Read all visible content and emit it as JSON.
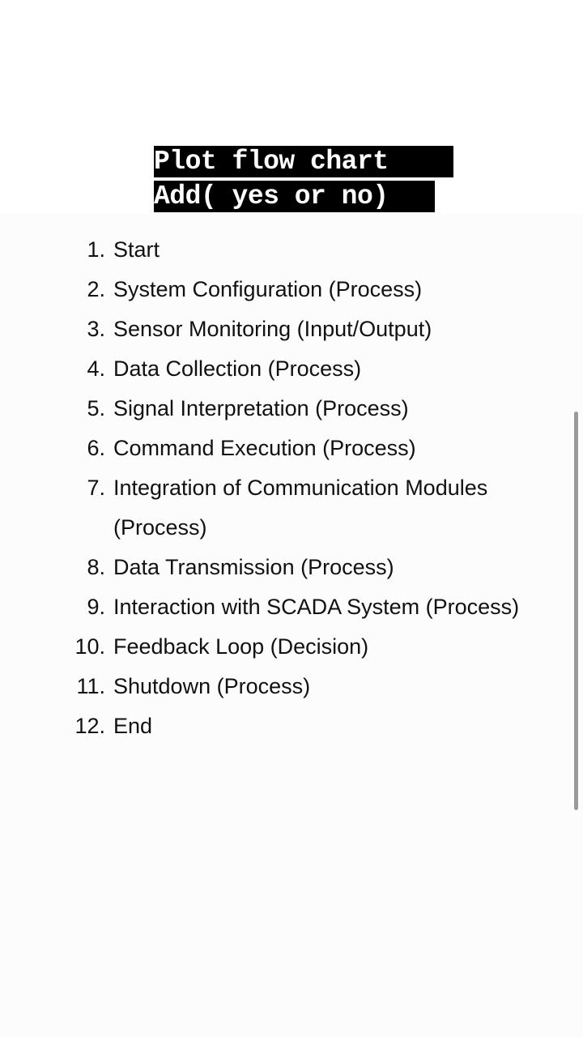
{
  "caption": {
    "line1": "Plot flow chart ",
    "line2": "Add( yes or no)"
  },
  "steps": [
    {
      "num": "1.",
      "text": "Start"
    },
    {
      "num": "2.",
      "text": "System Configuration (Process)"
    },
    {
      "num": "3.",
      "text": "Sensor Monitoring (Input/Output)"
    },
    {
      "num": "4.",
      "text": "Data Collection (Process)"
    },
    {
      "num": "5.",
      "text": "Signal Interpretation (Process)"
    },
    {
      "num": "6.",
      "text": "Command Execution (Process)"
    },
    {
      "num": "7.",
      "text": "Integration of Communication Modules (Process)"
    },
    {
      "num": "8.",
      "text": "Data Transmission (Process)"
    },
    {
      "num": "9.",
      "text": "Interaction with SCADA System (Process)"
    },
    {
      "num": "10.",
      "text": "Feedback Loop (Decision)"
    },
    {
      "num": "11.",
      "text": "Shutdown (Process)"
    },
    {
      "num": "12.",
      "text": "End"
    }
  ],
  "colors": {
    "caption_bg": "#000000",
    "caption_text": "#ffffff",
    "body_text": "#111111",
    "scrollbar": "#9a9a9a"
  }
}
